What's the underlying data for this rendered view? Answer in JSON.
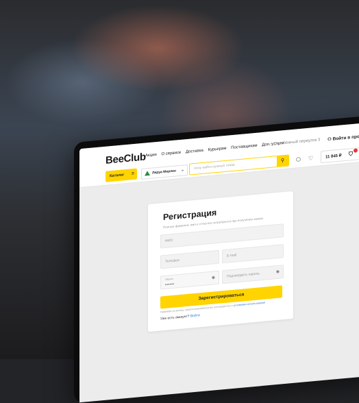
{
  "header": {
    "logo": "BeeClub",
    "tagline": "",
    "nav": [
      "Акции",
      "О сервисе",
      "Доставка",
      "Курьерам",
      "Поставщикам",
      "Доп. услуги"
    ],
    "address": "Осовбежный переулок 3",
    "login": "Войти в профиль",
    "catalog_label": "Каталог",
    "store_name": "Леруа Мерлен",
    "search_placeholder": "Хочу найти нужный товар",
    "cart_sum": "11 845 ₽"
  },
  "form": {
    "title": "Регистрация",
    "subtitle": "Полные фамилия, имя и отчество потребуются при получении заказа",
    "fio_placeholder": "ФИО",
    "phone_placeholder": "Телефон",
    "email_placeholder": "E-mail",
    "password_label": "Пароль",
    "password_value": "••••••",
    "confirm_placeholder": "Подтвердить пароль",
    "submit_label": "Зарегистрироваться",
    "legal_text": "Нажимая на кнопку, зарегистрироваться вы соглашаетесь с",
    "legal_link": "условиями использования",
    "have_account": "Уже есть аккаунт?",
    "login_link": "Войти"
  },
  "colors": {
    "accent": "#ffd400",
    "link": "#2a80d6",
    "badge": "#e53935"
  },
  "icons": [
    "location-icon",
    "user-icon",
    "menu-icon",
    "chevron-down-icon",
    "search-icon",
    "cube-icon",
    "heart-icon",
    "bag-icon",
    "eye-icon"
  ]
}
